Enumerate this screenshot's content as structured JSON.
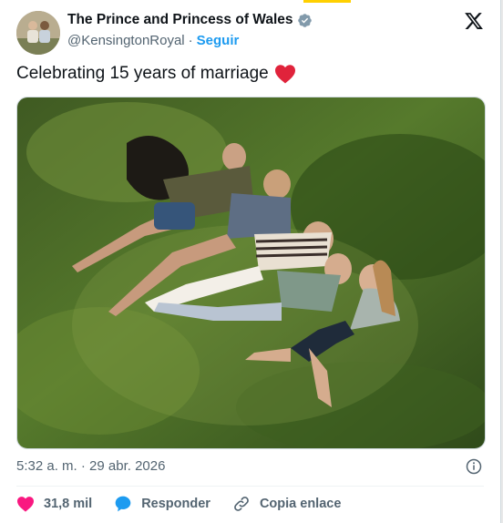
{
  "account": {
    "display_name": "The Prince and Princess of Wales",
    "handle": "@KensingtonRoyal",
    "separator": "·",
    "follow_label": "Seguir",
    "verified_badge_color": "#829aab"
  },
  "tweet": {
    "text": "Celebrating 15 years of marriage",
    "emoji": "red-heart"
  },
  "meta": {
    "timestamp": "5:32 a. m. · 29 abr. 2026"
  },
  "actions": {
    "likes": "31,8 mil",
    "reply_label": "Responder",
    "copy_link_label": "Copia enlace"
  },
  "colors": {
    "accent": "#1d9bf0",
    "like": "#f91880",
    "text_secondary": "#536471"
  },
  "icons": [
    "verified-badge-icon",
    "x-logo-icon",
    "heart-emoji-icon",
    "info-icon",
    "like-heart-icon",
    "reply-bubble-icon",
    "link-icon"
  ]
}
